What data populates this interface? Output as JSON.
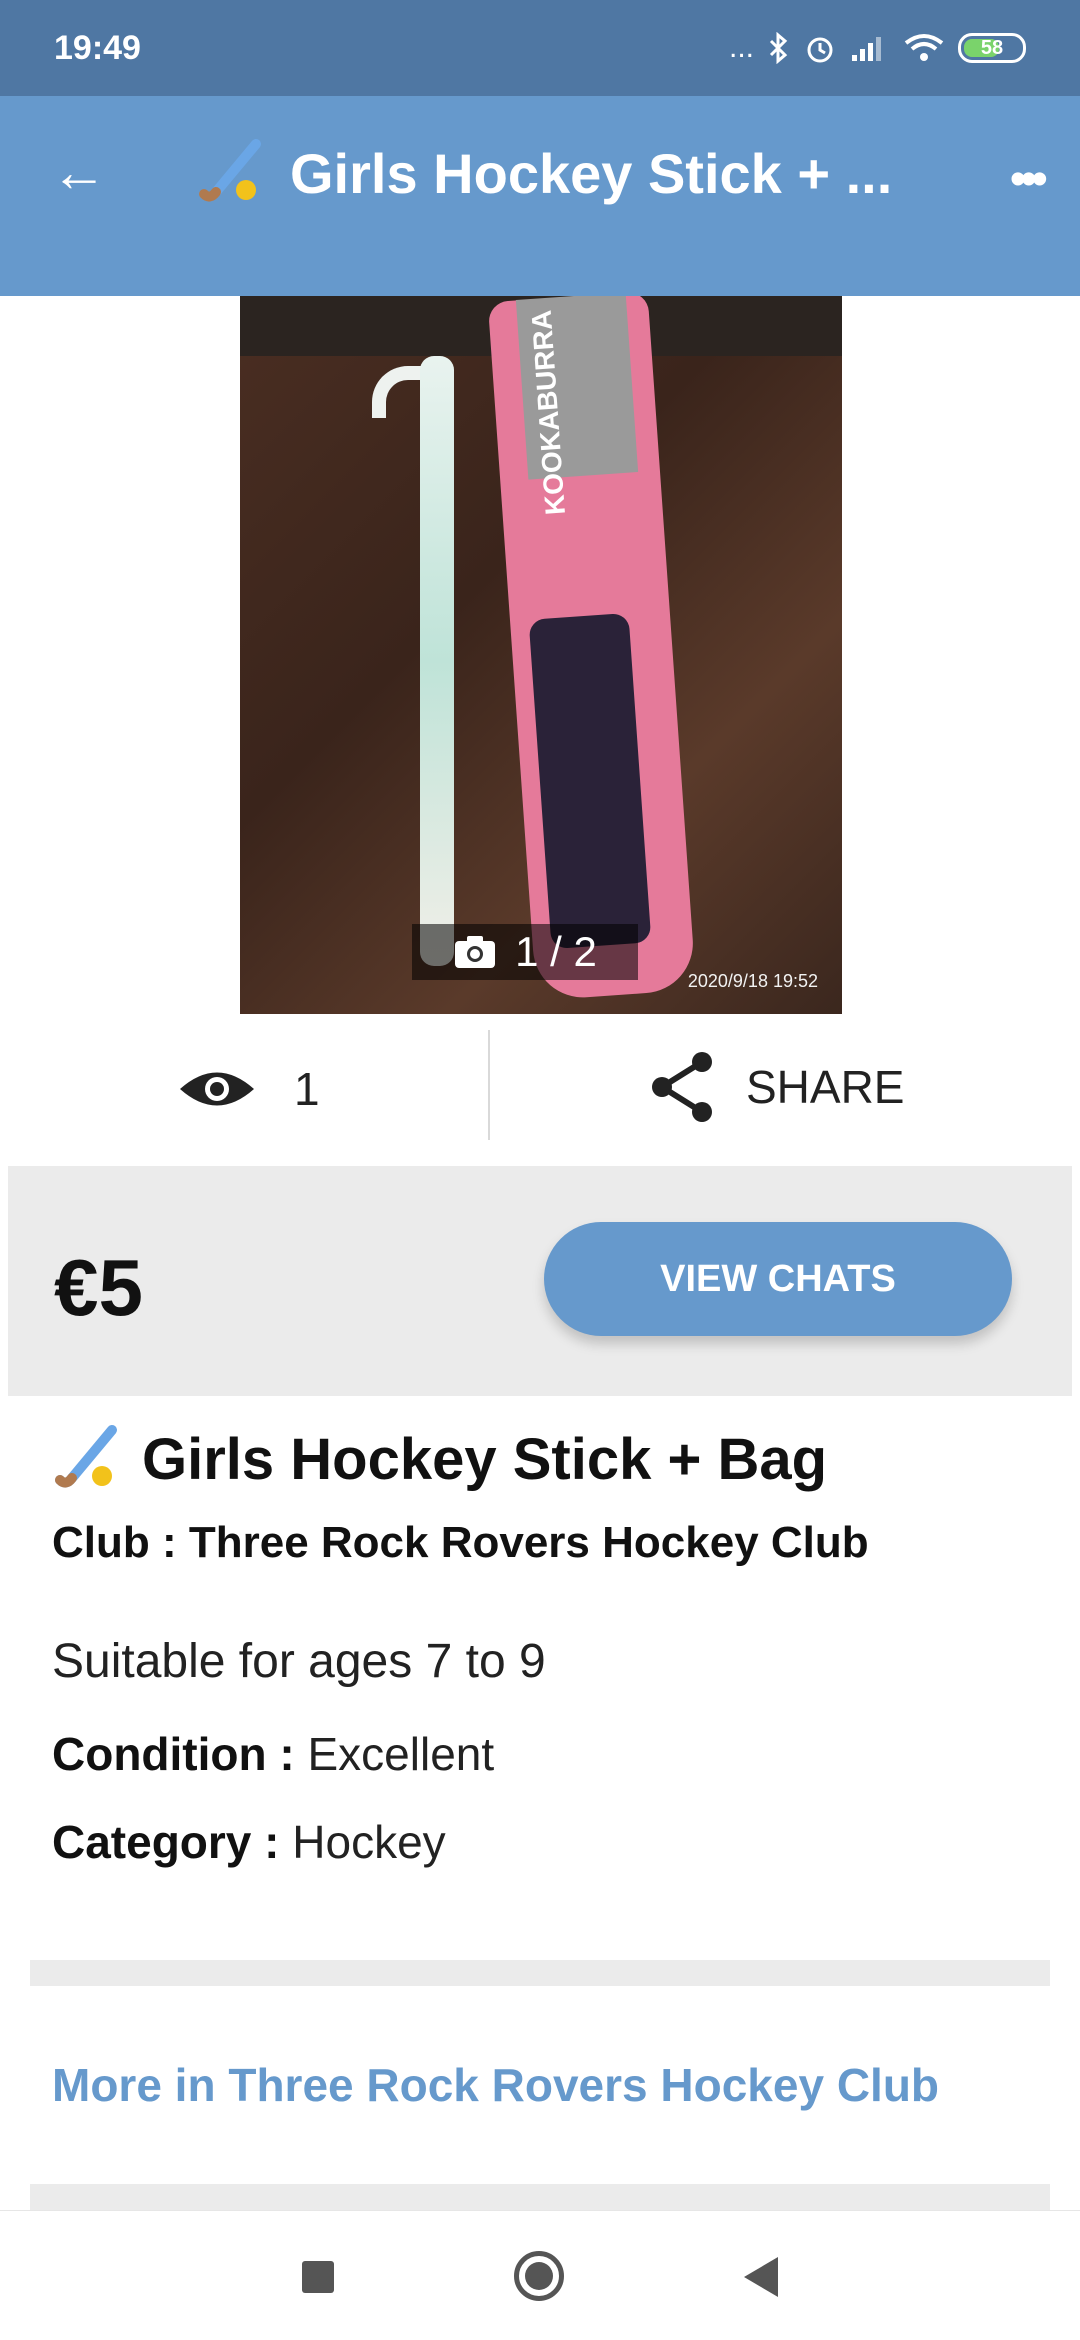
{
  "status_bar": {
    "time": "19:49",
    "signal_dots": "...",
    "battery_level": "58",
    "icons": [
      "bluetooth-icon",
      "alarm-icon",
      "signal-icon",
      "wifi-icon",
      "battery-icon"
    ]
  },
  "app_bar": {
    "back_icon": "←",
    "title": "Girls Hockey Stick + ...",
    "title_icon": "hockey-stick-icon",
    "more_icon": "•••"
  },
  "photo": {
    "counter_text": "1 / 2",
    "timestamp": "2020/9/18  19:52",
    "bag_brand": "KOOKABURRA"
  },
  "stats": {
    "views": "1",
    "share_label": "SHARE"
  },
  "listing": {
    "price": "€5",
    "view_chats_label": "VIEW CHATS",
    "title": "Girls Hockey Stick + Bag",
    "club": "Club : Three Rock Rovers Hockey Club",
    "description": "Suitable for ages 7 to 9",
    "condition_label": "Condition :",
    "condition_value": "Excellent",
    "category_label": "Category :",
    "category_value": "Hockey",
    "more_link": "More in Three Rock Rovers Hockey Club"
  },
  "colors": {
    "status_bar": "#4f77a3",
    "app_bar": "#6699cc",
    "accent": "#6699cc",
    "band": "#ebebeb"
  }
}
